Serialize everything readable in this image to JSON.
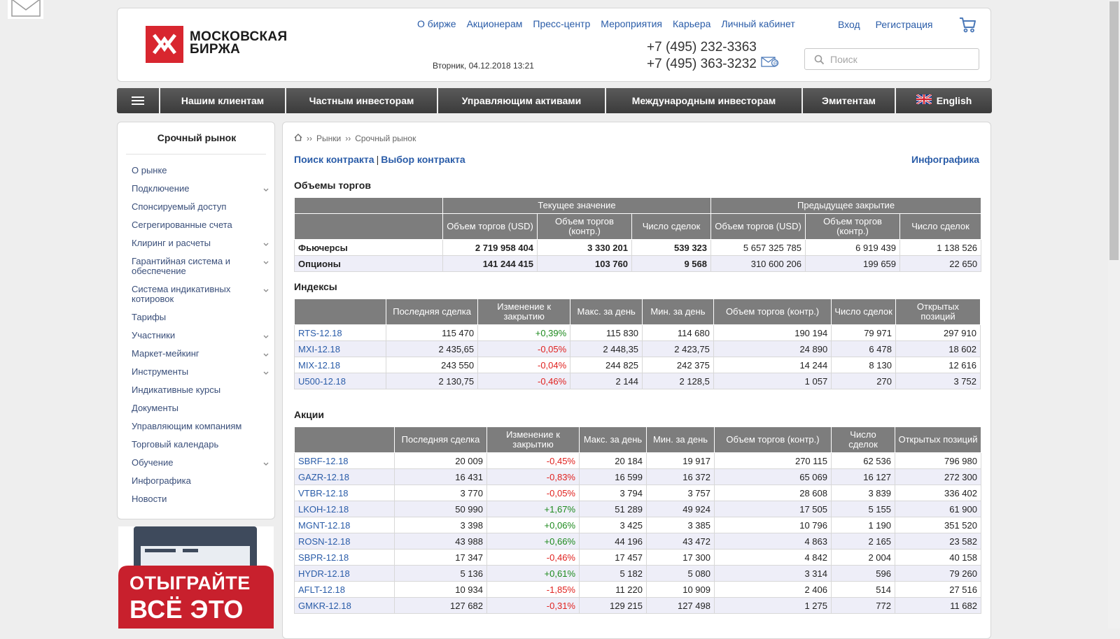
{
  "logo": {
    "line1": "МОСКОВСКАЯ",
    "line2": "БИРЖА"
  },
  "topnav": [
    "О бирже",
    "Акционерам",
    "Пресс-центр",
    "Мероприятия",
    "Карьера",
    "Личный кабинет"
  ],
  "auth": {
    "login": "Вход",
    "register": "Регистрация"
  },
  "date": "Вторник, 04.12.2018 13:21",
  "phones": [
    "+7 (495) 232-3363",
    "+7 (495) 363-3232"
  ],
  "search": {
    "placeholder": "Поиск"
  },
  "mainnav": [
    "Нашим клиентам",
    "Частным инвесторам",
    "Управляющим активами",
    "Международным инвесторам",
    "Эмитентам"
  ],
  "lang": "English",
  "sidebar": {
    "title": "Срочный рынок",
    "items": [
      {
        "label": "О рынке",
        "sub": false
      },
      {
        "label": "Подключение",
        "sub": true
      },
      {
        "label": "Спонсируемый доступ",
        "sub": false
      },
      {
        "label": "Сегрегированные счета",
        "sub": false
      },
      {
        "label": "Клиринг и расчеты",
        "sub": true
      },
      {
        "label": "Гарантийная система и обеспечение",
        "sub": true
      },
      {
        "label": "Система индикативных котировок",
        "sub": true
      },
      {
        "label": "Тарифы",
        "sub": false
      },
      {
        "label": "Участники",
        "sub": true
      },
      {
        "label": "Маркет-мейкинг",
        "sub": true
      },
      {
        "label": "Инструменты",
        "sub": true
      },
      {
        "label": "Индикативные курсы",
        "sub": false
      },
      {
        "label": "Документы",
        "sub": false
      },
      {
        "label": "Управляющим компаниям",
        "sub": false
      },
      {
        "label": "Торговый календарь",
        "sub": false
      },
      {
        "label": "Обучение",
        "sub": true
      },
      {
        "label": "Инфографика",
        "sub": false
      },
      {
        "label": "Новости",
        "sub": false
      }
    ]
  },
  "banner": {
    "line1": "ОТЫГРАЙТЕ",
    "line2": "ВСЁ ЭТО"
  },
  "breadcrumb": {
    "sep": "››",
    "items": [
      "Рынки",
      "Срочный рынок"
    ]
  },
  "tools": {
    "search_contract": "Поиск контракта",
    "divider": "|",
    "select_contract": "Выбор контракта",
    "infographics": "Инфографика"
  },
  "volumes": {
    "title": "Объемы торгов",
    "group_current": "Текущее значение",
    "group_prev": "Предыдущее закрытие",
    "columns": [
      "Объем торгов (USD)",
      "Объем торгов (контр.)",
      "Число сделок",
      "Объем торгов (USD)",
      "Объем торгов (контр.)",
      "Число сделок"
    ],
    "rows": [
      {
        "name": "Фьючерсы",
        "values": [
          "2 719 958 404",
          "3 330 201",
          "539 323",
          "5 657 325 785",
          "6 919 439",
          "1 138 526"
        ]
      },
      {
        "name": "Опционы",
        "values": [
          "141 244 415",
          "103 760",
          "9 568",
          "310 600 206",
          "199 659",
          "22 650"
        ]
      }
    ]
  },
  "indices": {
    "title": "Индексы",
    "columns": [
      "Последняя сделка",
      "Изменение к закрытию",
      "Макс. за день",
      "Мин. за день",
      "Объем торгов (контр.)",
      "Число сделок",
      "Открытых позиций"
    ],
    "rows": [
      {
        "name": "RTS-12.18",
        "last": "115 470",
        "change": "+0,39%",
        "dir": "pos",
        "max": "115 830",
        "min": "114 680",
        "vol": "190 194",
        "deals": "79 971",
        "oi": "297 910"
      },
      {
        "name": "MXI-12.18",
        "last": "2 435,65",
        "change": "-0,05%",
        "dir": "neg",
        "max": "2 448,35",
        "min": "2 423,75",
        "vol": "24 890",
        "deals": "6 478",
        "oi": "18 602"
      },
      {
        "name": "MIX-12.18",
        "last": "243 550",
        "change": "-0,04%",
        "dir": "neg",
        "max": "244 825",
        "min": "242 375",
        "vol": "14 244",
        "deals": "8 130",
        "oi": "12 616"
      },
      {
        "name": "U500-12.18",
        "last": "2 130,75",
        "change": "-0,46%",
        "dir": "neg",
        "max": "2 144",
        "min": "2 128,5",
        "vol": "1 057",
        "deals": "270",
        "oi": "3 752"
      }
    ]
  },
  "stocks": {
    "title": "Акции",
    "columns": [
      "Последняя сделка",
      "Изменение к закрытию",
      "Макс. за день",
      "Мин. за день",
      "Объем торгов (контр.)",
      "Число сделок",
      "Открытых позиций"
    ],
    "rows": [
      {
        "name": "SBRF-12.18",
        "last": "20 009",
        "change": "-0,45%",
        "dir": "neg",
        "max": "20 184",
        "min": "19 917",
        "vol": "270 115",
        "deals": "62 536",
        "oi": "796 980"
      },
      {
        "name": "GAZR-12.18",
        "last": "16 431",
        "change": "-0,83%",
        "dir": "neg",
        "max": "16 599",
        "min": "16 372",
        "vol": "65 069",
        "deals": "16 127",
        "oi": "272 300"
      },
      {
        "name": "VTBR-12.18",
        "last": "3 770",
        "change": "-0,05%",
        "dir": "neg",
        "max": "3 794",
        "min": "3 757",
        "vol": "28 608",
        "deals": "3 839",
        "oi": "336 402"
      },
      {
        "name": "LKOH-12.18",
        "last": "50 990",
        "change": "+1,67%",
        "dir": "pos",
        "max": "51 289",
        "min": "49 924",
        "vol": "17 505",
        "deals": "5 155",
        "oi": "61 900"
      },
      {
        "name": "MGNT-12.18",
        "last": "3 398",
        "change": "+0,06%",
        "dir": "pos",
        "max": "3 425",
        "min": "3 385",
        "vol": "10 796",
        "deals": "1 190",
        "oi": "351 520"
      },
      {
        "name": "ROSN-12.18",
        "last": "43 988",
        "change": "+0,66%",
        "dir": "pos",
        "max": "44 196",
        "min": "43 472",
        "vol": "4 863",
        "deals": "2 165",
        "oi": "23 582"
      },
      {
        "name": "SBPR-12.18",
        "last": "17 347",
        "change": "-0,46%",
        "dir": "neg",
        "max": "17 457",
        "min": "17 300",
        "vol": "4 842",
        "deals": "2 004",
        "oi": "40 158"
      },
      {
        "name": "HYDR-12.18",
        "last": "5 136",
        "change": "+0,61%",
        "dir": "pos",
        "max": "5 182",
        "min": "5 080",
        "vol": "3 314",
        "deals": "596",
        "oi": "79 260"
      },
      {
        "name": "AFLT-12.18",
        "last": "10 934",
        "change": "-1,85%",
        "dir": "neg",
        "max": "11 220",
        "min": "10 909",
        "vol": "2 406",
        "deals": "514",
        "oi": "27 516"
      },
      {
        "name": "GMKR-12.18",
        "last": "127 682",
        "change": "-0,31%",
        "dir": "neg",
        "max": "129 215",
        "min": "127 498",
        "vol": "1 275",
        "deals": "772",
        "oi": "11 682"
      }
    ]
  },
  "colors": {
    "brand_red": "#d8262f",
    "link": "#2a5ca8",
    "positive": "#1d8a1d",
    "negative": "#e0221f",
    "header_gray": "#7d7d7d"
  }
}
